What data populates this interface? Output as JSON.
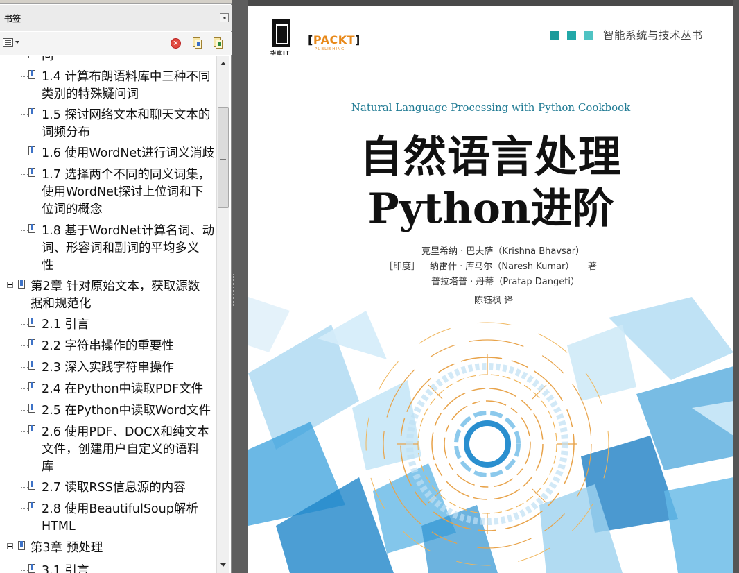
{
  "bookmarks_panel": {
    "title": "书签",
    "items": [
      {
        "id": "i0",
        "kind": "sub",
        "text": "问"
      },
      {
        "id": "i1",
        "kind": "sub",
        "text": "1.4 计算布朗语料库中三种不同\n类别的特殊疑问词"
      },
      {
        "id": "i2",
        "kind": "sub",
        "text": "1.5 探讨网络文本和聊天文本的\n词频分布"
      },
      {
        "id": "i3",
        "kind": "sub",
        "text": "1.6 使用WordNet进行词义消歧"
      },
      {
        "id": "i4",
        "kind": "sub",
        "text": "1.7 选择两个不同的同义词集，\n使用WordNet探讨上位词和下\n位词的概念"
      },
      {
        "id": "i5",
        "kind": "sub",
        "text": "1.8 基于WordNet计算名词、动\n词、形容词和副词的平均多义\n性"
      },
      {
        "id": "i6",
        "kind": "chapter",
        "text": "第2章 针对原始文本，获取源数\n据和规范化"
      },
      {
        "id": "i7",
        "kind": "sub",
        "text": "2.1 引言"
      },
      {
        "id": "i8",
        "kind": "sub",
        "text": "2.2 字符串操作的重要性"
      },
      {
        "id": "i9",
        "kind": "sub",
        "text": "2.3 深入实践字符串操作"
      },
      {
        "id": "i10",
        "kind": "sub",
        "text": "2.4 在Python中读取PDF文件"
      },
      {
        "id": "i11",
        "kind": "sub",
        "text": "2.5 在Python中读取Word文件"
      },
      {
        "id": "i12",
        "kind": "sub",
        "text": "2.6 使用PDF、DOCX和纯文本\n文件，创建用户自定义的语料\n库"
      },
      {
        "id": "i13",
        "kind": "sub",
        "text": "2.7 读取RSS信息源的内容"
      },
      {
        "id": "i14",
        "kind": "sub",
        "text": "2.8 使用BeautifulSoup解析\nHTML"
      },
      {
        "id": "i15",
        "kind": "chapter",
        "text": "第3章 预处理"
      },
      {
        "id": "i16",
        "kind": "sub",
        "text": "3.1 引言"
      }
    ]
  },
  "cover": {
    "publisher_logo_text": "华章IT",
    "packt_logo": "PACKT",
    "packt_sub": "PUBLISHING",
    "series": "智能系统与技术丛书",
    "series_colors": [
      "#1b9a9a",
      "#22a8a8",
      "#4fc3c3"
    ],
    "english_title": "Natural Language Processing with Python Cookbook",
    "title_line1": "自然语言处理",
    "title_line2": "Python进阶",
    "author1": "克里希纳 · 巴夫萨（Krishna Bhavsar）",
    "author_country": "［印度］",
    "author2": "纳雷什 · 库马尔（Naresh Kumar）",
    "author_suffix": "著",
    "author3": "普拉塔普 · 丹蒂（Pratap Dangeti）",
    "translator": "陈钰枫 译",
    "accent_blue": "#2a9ad6",
    "accent_orange": "#e8a34a"
  }
}
